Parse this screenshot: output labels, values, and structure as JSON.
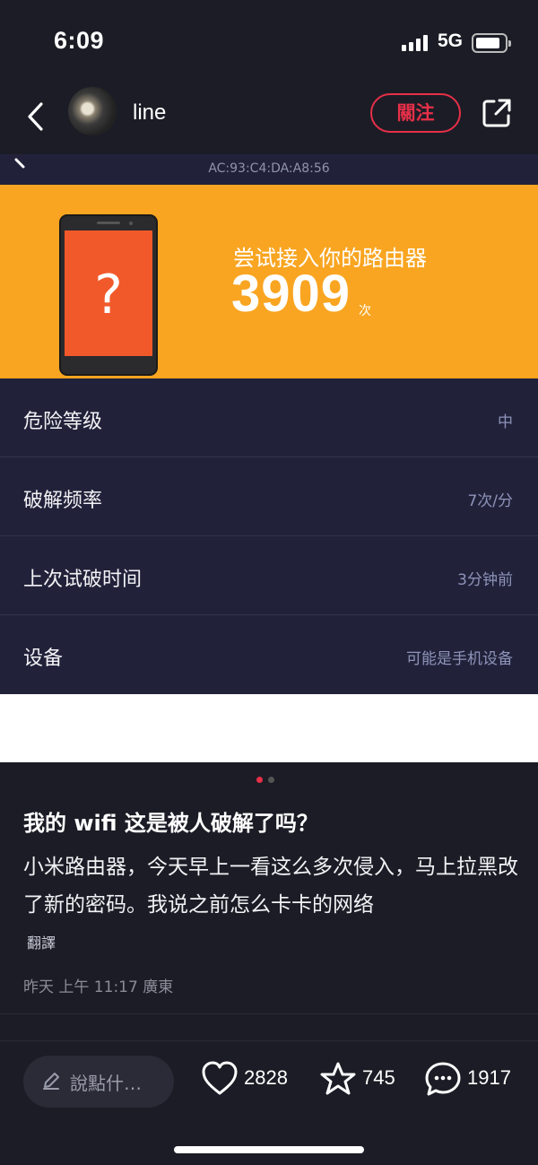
{
  "status_bar": {
    "time": "6:09",
    "network": "5G"
  },
  "nav": {
    "username": "line",
    "follow_label": "關注"
  },
  "embedded_screen": {
    "mac_address": "AC:93:C4:DA:A8:56",
    "banner": {
      "attempt_label": "尝试接入你的路由器",
      "attempt_count": "3909",
      "attempt_unit": "次",
      "device_icon": "phone-question-icon"
    },
    "rows": [
      {
        "label": "危险等级",
        "value": "中"
      },
      {
        "label": "破解频率",
        "value": "7次/分"
      },
      {
        "label": "上次试破时间",
        "value": "3分钟前"
      },
      {
        "label": "设备",
        "value": "可能是手机设备"
      }
    ]
  },
  "post": {
    "title": "我的 wifi 这是被人破解了吗？",
    "body": "小米路由器，今天早上一看这么多次侵入，马上拉黑改了新的密码。我说之前怎么卡卡的网络",
    "translate_label": "翻譯",
    "meta": "昨天 上午 11:17 廣東",
    "carousel": {
      "count": 2,
      "active": 1
    }
  },
  "actions": {
    "comment_placeholder": "說點什…",
    "likes": "2828",
    "favorites": "745",
    "comments": "1917"
  },
  "colors": {
    "background": "#1c1c26",
    "panel": "#21223a",
    "banner": "#f9a521",
    "accent_red": "#e63048",
    "phone_screen": "#f2592a"
  }
}
